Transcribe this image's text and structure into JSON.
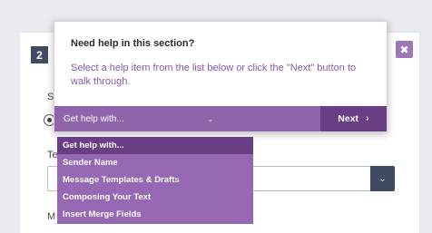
{
  "background": {
    "step_number": "2",
    "close_symbol": "✖",
    "labels": {
      "se_partial": "Se",
      "te_partial": "Te",
      "m_partial": "M"
    },
    "select_chevron": "⌄"
  },
  "help_popover": {
    "title": "Need help in this section?",
    "body": "Select a help item from the list below or click the \"Next\" button to walk through.",
    "select_value": "Get help with...",
    "select_chevron": "⌄",
    "next_label": "Next",
    "next_arrow": "›"
  },
  "dropdown": {
    "items": [
      {
        "label": "Get help with..."
      },
      {
        "label": "Sender Name"
      },
      {
        "label": "Message Templates & Drafts"
      },
      {
        "label": "Composing Your Text"
      },
      {
        "label": "Insert Merge Fields"
      }
    ],
    "selected_index": 0
  },
  "colors": {
    "purple_bar": "#8f64aa",
    "purple_dark": "#6a3e85",
    "navy": "#3f4b63",
    "body_purple_text": "#8a5aa6"
  }
}
